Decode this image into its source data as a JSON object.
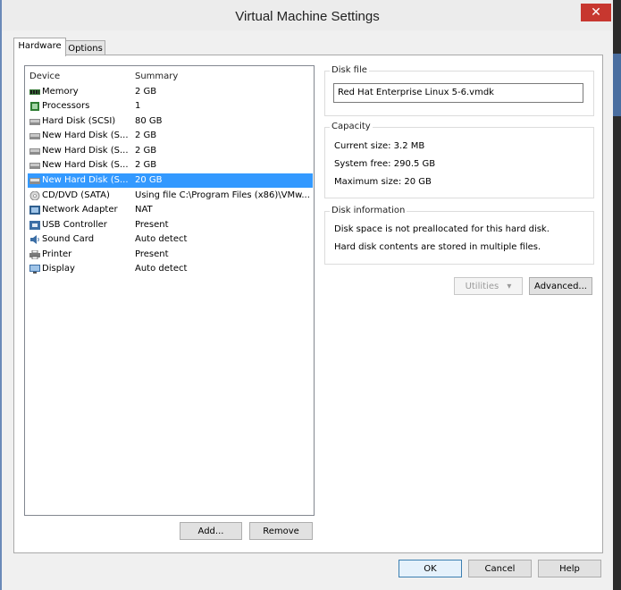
{
  "window": {
    "title": "Virtual Machine Settings",
    "close_glyph": "✕"
  },
  "tabs": [
    {
      "label": "Hardware",
      "active": true
    },
    {
      "label": "Options",
      "active": false
    }
  ],
  "device_list": {
    "columns": {
      "device": "Device",
      "summary": "Summary"
    },
    "rows": [
      {
        "device": "Memory",
        "summary": "2 GB",
        "icon": "memory-icon"
      },
      {
        "device": "Processors",
        "summary": "1",
        "icon": "processor-icon"
      },
      {
        "device": "Hard Disk (SCSI)",
        "summary": "80 GB",
        "icon": "hard-disk-icon"
      },
      {
        "device": "New Hard Disk (S...",
        "summary": "2 GB",
        "icon": "hard-disk-icon"
      },
      {
        "device": "New Hard Disk (S...",
        "summary": "2 GB",
        "icon": "hard-disk-icon"
      },
      {
        "device": "New Hard Disk (S...",
        "summary": "2 GB",
        "icon": "hard-disk-icon"
      },
      {
        "device": "New Hard Disk (S...",
        "summary": "20 GB",
        "icon": "hard-disk-icon",
        "selected": true
      },
      {
        "device": "CD/DVD (SATA)",
        "summary": "Using file C:\\Program Files (x86)\\VMw...",
        "icon": "cd-dvd-icon"
      },
      {
        "device": "Network Adapter",
        "summary": "NAT",
        "icon": "network-adapter-icon"
      },
      {
        "device": "USB Controller",
        "summary": "Present",
        "icon": "usb-icon"
      },
      {
        "device": "Sound Card",
        "summary": "Auto detect",
        "icon": "sound-card-icon"
      },
      {
        "device": "Printer",
        "summary": "Present",
        "icon": "printer-icon"
      },
      {
        "device": "Display",
        "summary": "Auto detect",
        "icon": "display-icon"
      }
    ]
  },
  "list_buttons": {
    "add": "Add...",
    "remove": "Remove"
  },
  "disk_file": {
    "title": "Disk file",
    "value": "Red Hat Enterprise Linux 5-6.vmdk"
  },
  "capacity": {
    "title": "Capacity",
    "current_size": "Current size: 3.2 MB",
    "system_free": "System free: 290.5 GB",
    "maximum_size": "Maximum size: 20 GB"
  },
  "disk_information": {
    "title": "Disk information",
    "line1": "Disk space is not preallocated for this hard disk.",
    "line2": "Hard disk contents are stored in multiple files."
  },
  "disk_buttons": {
    "utilities": "Utilities",
    "advanced": "Advanced..."
  },
  "dialog_buttons": {
    "ok": "OK",
    "cancel": "Cancel",
    "help": "Help"
  },
  "colors": {
    "selection": "#3399ff",
    "close": "#c7372f"
  }
}
